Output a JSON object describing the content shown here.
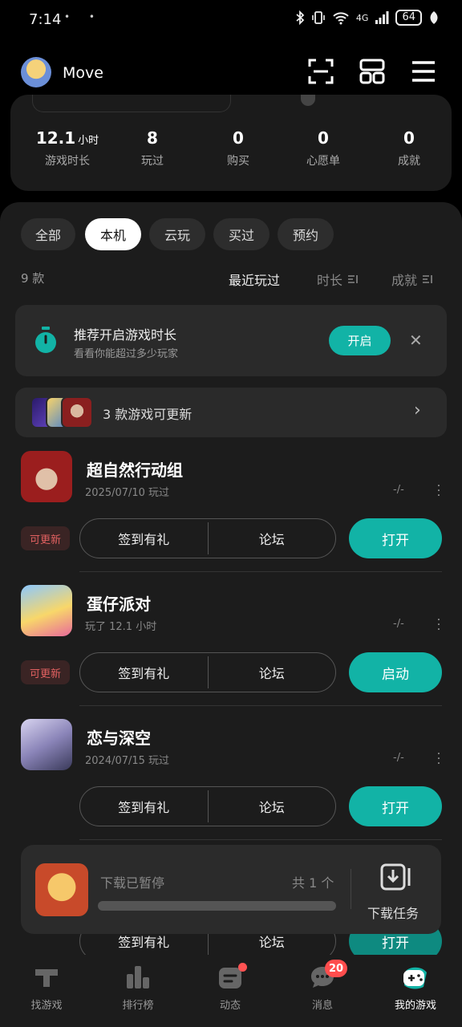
{
  "status_bar": {
    "time": "7:14",
    "extra": "• •",
    "network": "4G",
    "battery": "64"
  },
  "header": {
    "username": "Move"
  },
  "stats": [
    {
      "value": "12.1",
      "unit": "小时",
      "label": "游戏时长"
    },
    {
      "value": "8",
      "unit": "",
      "label": "玩过"
    },
    {
      "value": "0",
      "unit": "",
      "label": "购买"
    },
    {
      "value": "0",
      "unit": "",
      "label": "心愿单"
    },
    {
      "value": "0",
      "unit": "",
      "label": "成就"
    }
  ],
  "tabs": [
    "全部",
    "本机",
    "云玩",
    "买过",
    "预约"
  ],
  "active_tab": "本机",
  "count_label": "9 款",
  "sort": {
    "recent": "最近玩过",
    "duration": "时长",
    "achievement": "成就"
  },
  "tip": {
    "title": "推荐开启游戏时长",
    "subtitle": "看看你能超过多少玩家",
    "button": "开启",
    "close": "✕"
  },
  "update_banner": {
    "text": "3 款游戏可更新",
    "chevron": "›"
  },
  "games": [
    {
      "name": "超自然行动组",
      "meta": "2025/07/10 玩过",
      "rating": "-/-",
      "update_badge": "可更新",
      "checkin": "签到有礼",
      "forum": "论坛",
      "action": "打开"
    },
    {
      "name": "蛋仔派对",
      "meta": "玩了 12.1 小时",
      "rating": "-/-",
      "update_badge": "可更新",
      "checkin": "签到有礼",
      "forum": "论坛",
      "action": "启动"
    },
    {
      "name": "恋与深空",
      "meta": "2024/07/15 玩过",
      "rating": "-/-",
      "update_badge": "",
      "checkin": "签到有礼",
      "forum": "论坛",
      "action": "打开"
    },
    {
      "name": "",
      "meta": "",
      "rating": "",
      "update_badge": "",
      "checkin": "签到有礼",
      "forum": "论坛",
      "action": "打开"
    }
  ],
  "download": {
    "status": "下载已暂停",
    "count": "共 1 个",
    "task_label": "下载任务",
    "progress": 0
  },
  "nav": [
    {
      "label": "找游戏",
      "icon": "find-games-icon"
    },
    {
      "label": "排行榜",
      "icon": "ranking-icon"
    },
    {
      "label": "动态",
      "icon": "feed-icon"
    },
    {
      "label": "消息",
      "icon": "message-icon",
      "badge": "20"
    },
    {
      "label": "我的游戏",
      "icon": "my-games-icon"
    }
  ],
  "colors": {
    "accent": "#12b3a6",
    "badge": "#ff4d4d",
    "update_text": "#e06060"
  }
}
